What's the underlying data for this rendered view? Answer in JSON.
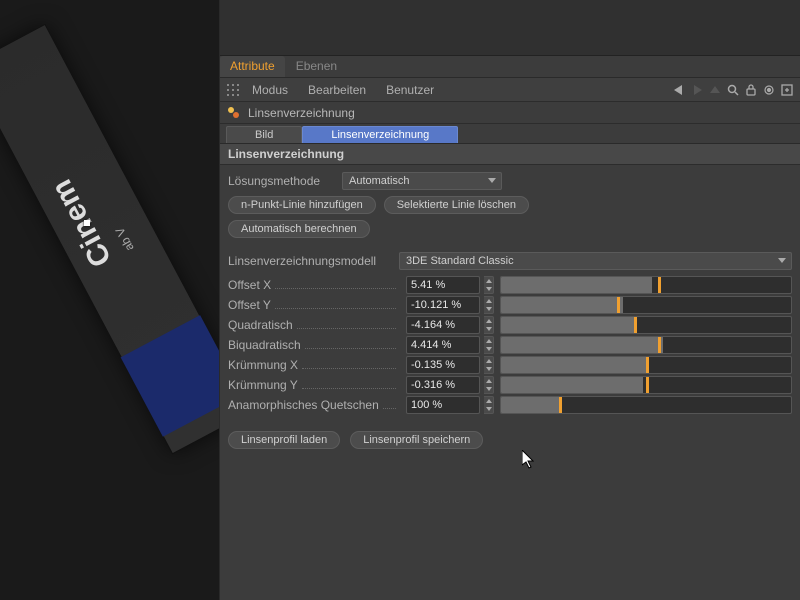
{
  "tabs": {
    "attribute": "Attribute",
    "ebenen": "Ebenen"
  },
  "menubar": {
    "modus": "Modus",
    "bearbeiten": "Bearbeiten",
    "benutzer": "Benutzer"
  },
  "object": {
    "name": "Linsenverzeichnung"
  },
  "subtabs": {
    "bild": "Bild",
    "lens": "Linsenverzeichnung"
  },
  "section": {
    "header": "Linsenverzeichnung"
  },
  "solver": {
    "label": "Lösungsmethode",
    "value": "Automatisch",
    "btn_addline": "n-Punkt-Linie hinzufügen",
    "btn_delete": "Selektierte Linie löschen",
    "btn_auto": "Automatisch berechnen"
  },
  "model": {
    "label": "Linsenverzeichnungsmodell",
    "value": "3DE Standard Classic"
  },
  "params": [
    {
      "label": "Offset X",
      "value": "5.41 %",
      "fill": 52,
      "mark": 54
    },
    {
      "label": "Offset Y",
      "value": "-10.121 %",
      "fill": 42,
      "mark": 40
    },
    {
      "label": "Quadratisch",
      "value": "-4.164 %",
      "fill": 46,
      "mark": 46
    },
    {
      "label": "Biquadratisch",
      "value": "4.414 %",
      "fill": 56,
      "mark": 54
    },
    {
      "label": "Krümmung X",
      "value": "-0.135 %",
      "fill": 50,
      "mark": 50
    },
    {
      "label": "Krümmung Y",
      "value": "-0.316 %",
      "fill": 49,
      "mark": 50
    },
    {
      "label": "Anamorphisches Quetschen",
      "value": "100 %",
      "fill": 20,
      "mark": 20
    }
  ],
  "footer": {
    "load": "Linsenprofil laden",
    "save": "Linsenprofil speichern"
  },
  "viewport": {
    "book_title": "Cinem",
    "book_sub": "ab V"
  },
  "colors": {
    "accent": "#f0a030",
    "tab_active": "#5878c8"
  }
}
